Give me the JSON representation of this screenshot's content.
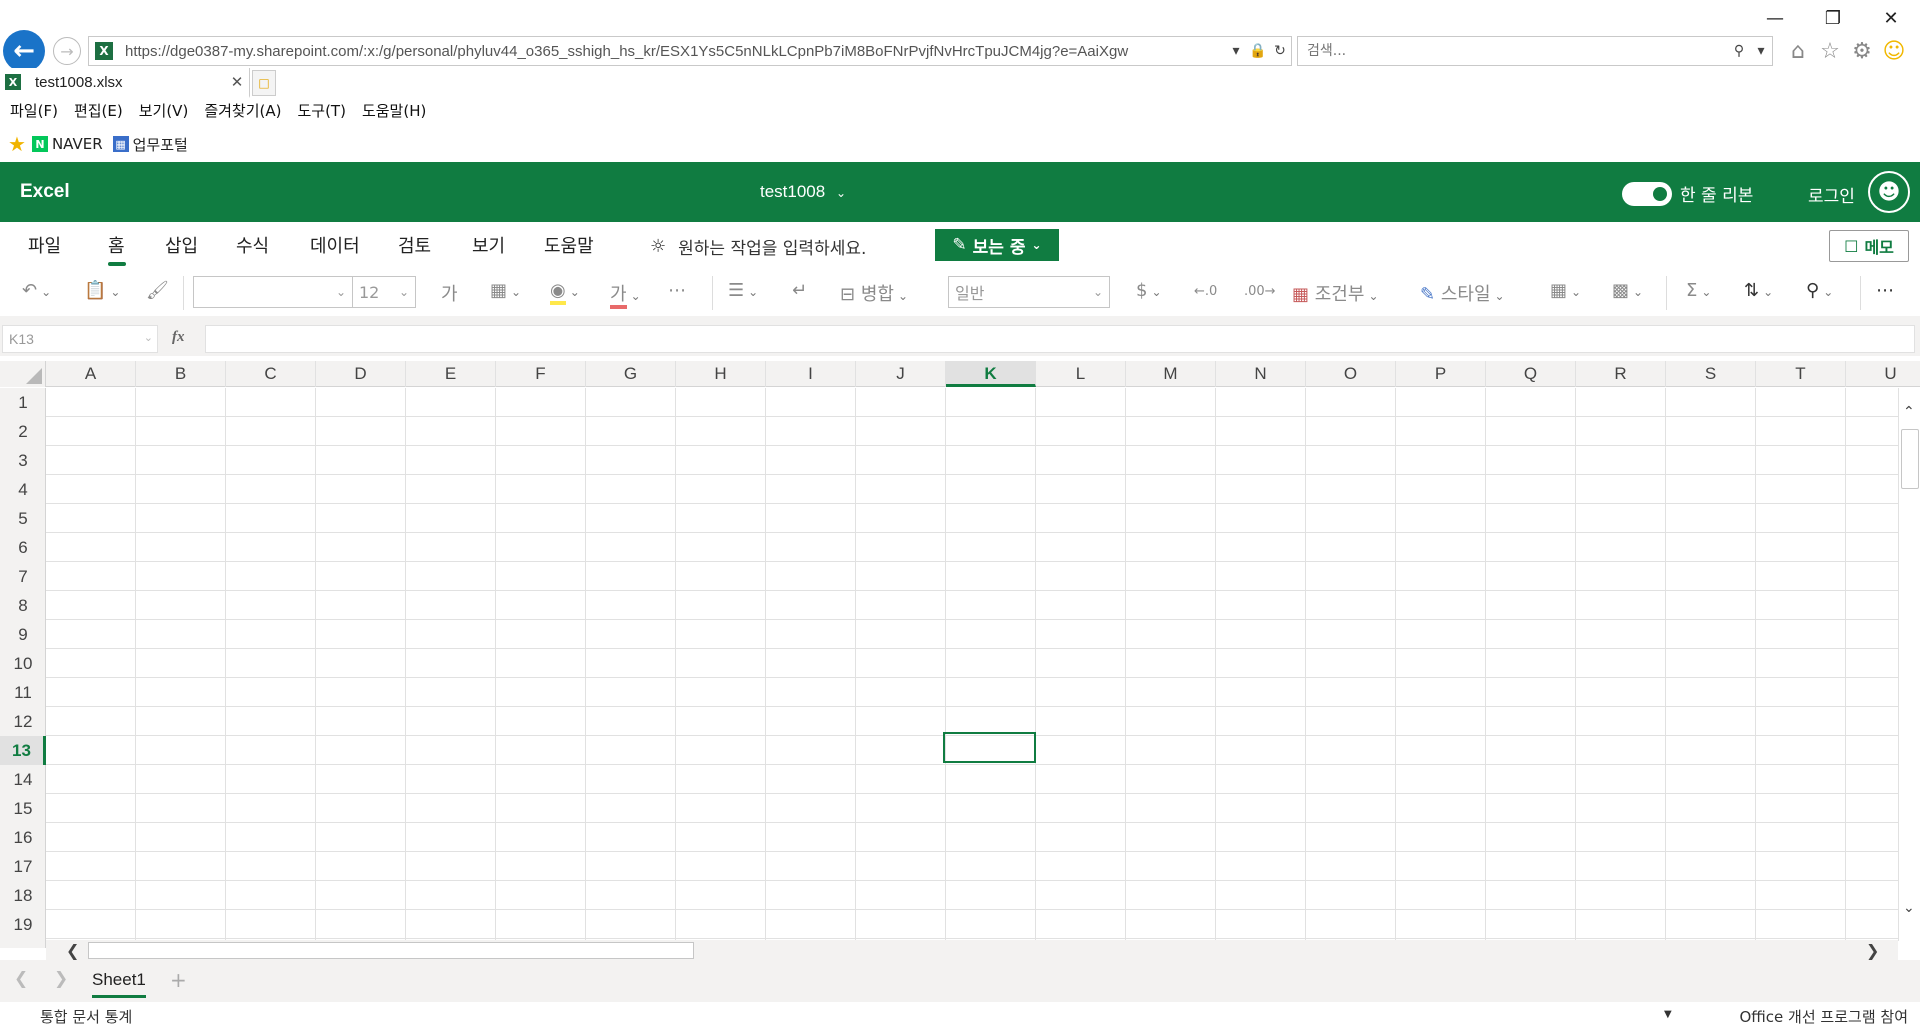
{
  "browser": {
    "url": "https://dge0387-my.sharepoint.com/:x:/g/personal/phyluv44_o365_sshigh_hs_kr/ESX1Ys5C5nNLkLCpnPb7iM8BoFNrPvjfNvHrcTpuJCM4jg?e=AaiXgw",
    "search_placeholder": "검색...",
    "tab_title": "test1008.xlsx",
    "menu": [
      "파일(F)",
      "편집(E)",
      "보기(V)",
      "즐겨찾기(A)",
      "도구(T)",
      "도움말(H)"
    ],
    "favorites": {
      "naver": "NAVER",
      "portal": "업무포털"
    }
  },
  "excel": {
    "app_name": "Excel",
    "doc_title": "test1008",
    "ribbon_toggle_label": "한 줄 리본",
    "login_label": "로그인",
    "tabs": [
      "파일",
      "홈",
      "삽입",
      "수식",
      "데이터",
      "검토",
      "보기",
      "도움말"
    ],
    "active_tab": "홈",
    "tell_me": "원하는 작업을 입력하세요.",
    "viewing_label": "보는 중",
    "memo_label": "메모",
    "toolbar": {
      "bold_label": "가",
      "font_color_label": "가",
      "font_size": "12",
      "merge_label": "병합",
      "number_format": "일반",
      "currency_label": "$",
      "cond_format_label": "조건부",
      "styles_label": "스타일"
    },
    "name_box": "K13",
    "fx_label": "fx",
    "columns": [
      "A",
      "B",
      "C",
      "D",
      "E",
      "F",
      "G",
      "H",
      "I",
      "J",
      "K",
      "L",
      "M",
      "N",
      "O",
      "P",
      "Q",
      "R",
      "S",
      "T",
      "U"
    ],
    "rows": [
      "1",
      "2",
      "3",
      "4",
      "5",
      "6",
      "7",
      "8",
      "9",
      "10",
      "11",
      "12",
      "13",
      "14",
      "15",
      "16",
      "17",
      "18",
      "19"
    ],
    "active_column": "K",
    "active_row": "13",
    "sheet_tab": "Sheet1",
    "status_text": "통합 문서 통계",
    "status_program": "Office 개선 프로그램 참여"
  }
}
